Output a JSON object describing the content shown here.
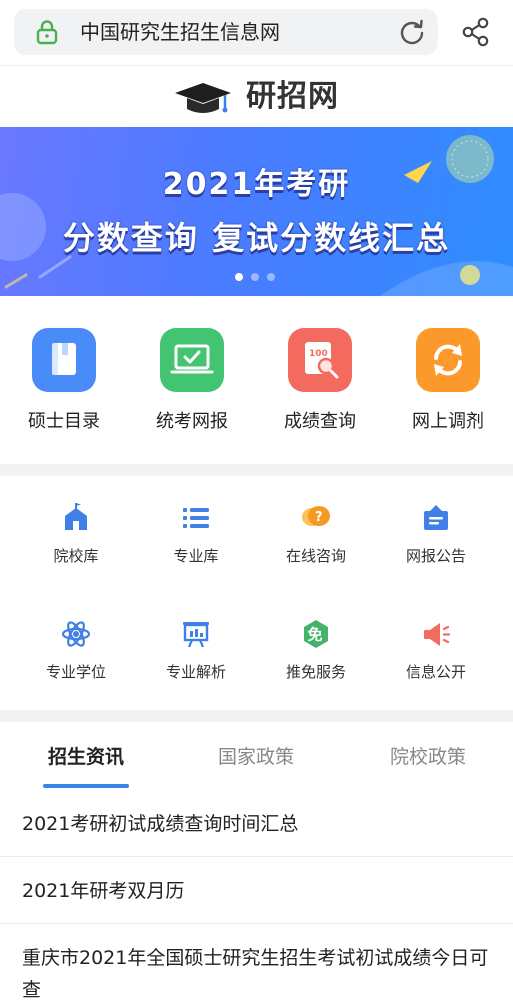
{
  "browser": {
    "url_title": "中国研究生招生信息网",
    "icons": {
      "lock": "lock-icon",
      "reload": "reload-icon",
      "share": "share-icon"
    },
    "lock_color": "#4caf50"
  },
  "logo": {
    "text": "研招网",
    "icon": "graduation-cap-icon"
  },
  "banner": {
    "line1": "2021年考研",
    "line2": "分数查询  复试分数线汇总",
    "pages": 3,
    "active_page": 1
  },
  "main_nav": [
    {
      "label": "硕士目录",
      "icon": "book-icon",
      "color": "#4a8cf7"
    },
    {
      "label": "统考网报",
      "icon": "laptop-check-icon",
      "color": "#43c472"
    },
    {
      "label": "成绩查询",
      "icon": "score-search-icon",
      "color": "#f36b5f"
    },
    {
      "label": "网上调剂",
      "icon": "swap-icon",
      "color": "#fb9a2b"
    }
  ],
  "sub_nav": [
    {
      "label": "院校库",
      "icon": "school-icon",
      "color": "#3f7fe6"
    },
    {
      "label": "专业库",
      "icon": "list-icon",
      "color": "#3f7fe6"
    },
    {
      "label": "在线咨询",
      "icon": "chat-question-icon",
      "color": "#f59a23"
    },
    {
      "label": "网报公告",
      "icon": "notice-icon",
      "color": "#3f7fe6"
    },
    {
      "label": "专业学位",
      "icon": "atom-icon",
      "color": "#3f7fe6"
    },
    {
      "label": "专业解析",
      "icon": "presentation-icon",
      "color": "#3f7fe6"
    },
    {
      "label": "推免服务",
      "icon": "exempt-badge-icon",
      "color": "#43b36b",
      "badge": "免"
    },
    {
      "label": "信息公开",
      "icon": "megaphone-icon",
      "color": "#f16b5f"
    }
  ],
  "tabs": [
    {
      "label": "招生资讯",
      "active": true
    },
    {
      "label": "国家政策",
      "active": false
    },
    {
      "label": "院校政策",
      "active": false
    }
  ],
  "accent_color": "#3a82e6",
  "news": [
    {
      "title": "2021考研初试成绩查询时间汇总"
    },
    {
      "title": "2021年研考双月历"
    },
    {
      "title": "重庆市2021年全国硕士研究生招生考试初试成绩今日可查"
    }
  ]
}
